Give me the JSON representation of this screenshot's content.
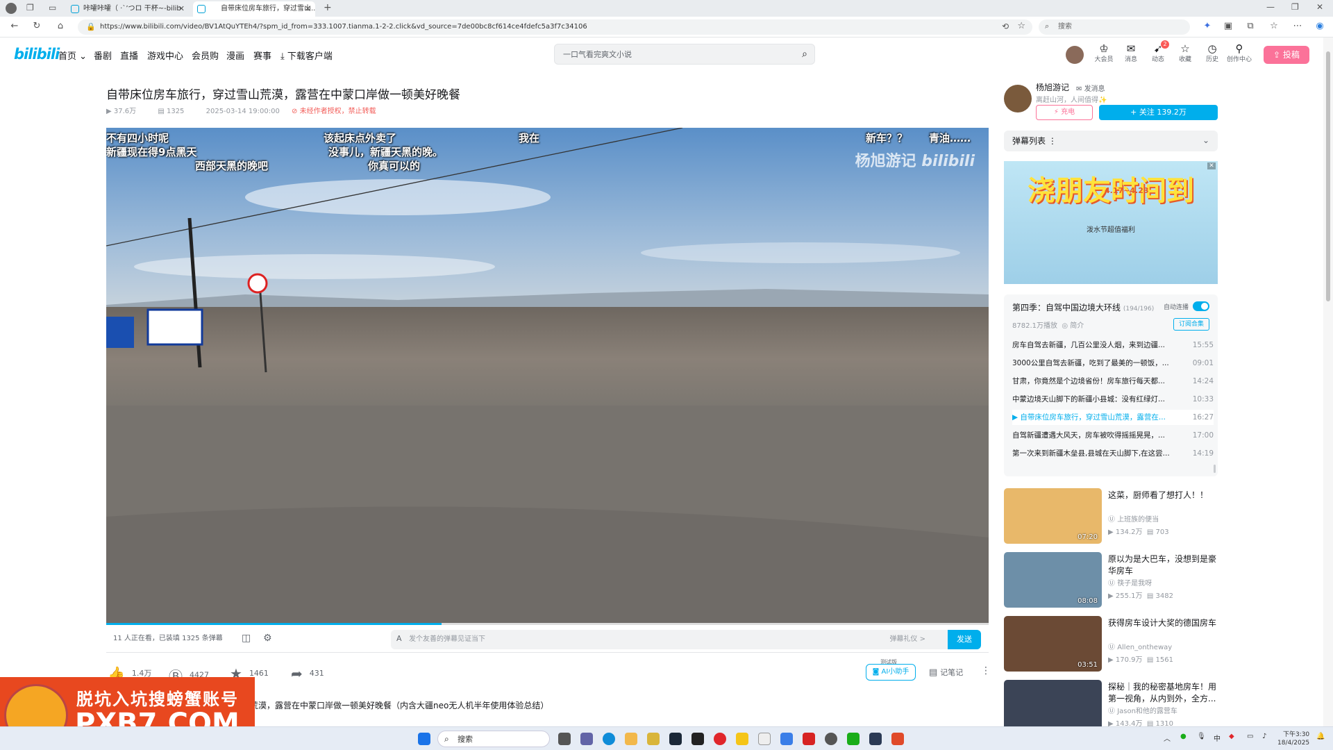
{
  "browser": {
    "tabs": [
      {
        "label": "咔嚯咔嚯（ ·`’つロ 干杯~-bilib",
        "active": false
      },
      {
        "label": "自带床位房车旅行，穿过雪山...",
        "active": true
      }
    ],
    "url": "https://www.bilibili.com/video/BV1AtQuYTEh4/?spm_id_from=333.1007.tianma.1-2-2.click&vd_source=7de00bc8cf614ce4fdefc5a3f7c34106",
    "search_placeholder": "搜索"
  },
  "header": {
    "logo": "bilibili",
    "nav": [
      "首页",
      "番剧",
      "直播",
      "游戏中心",
      "会员购",
      "漫画",
      "赛事",
      "下载客户端"
    ],
    "search_placeholder": "一口气看完爽文小说",
    "right_items": [
      "大会员",
      "消息",
      "动态",
      "收藏",
      "历史",
      "创作中心"
    ],
    "dynamic_badge": "2",
    "upload_label": "投稿"
  },
  "video": {
    "title": "自带床位房车旅行，穿过雪山荒漠，露营在中蒙口岸做一顿美好晚餐",
    "views": "37.6万",
    "danmaku_count": "1325",
    "date": "2025-03-14 19:00:00",
    "copyright": "未经作者授权，禁止转载",
    "watermark": "杨旭游记",
    "danmaku": [
      "不有四小时呢",
      "新疆现在得9点黑天",
      "西部天黑的晚吧",
      "该起床点外卖了",
      "没事儿，新疆天黑的晚。",
      "你真可以的",
      "我在",
      "新车？？",
      "青油……"
    ],
    "progress": 0.38,
    "dm_status": "11 人正在看，已装填 1325 条弹幕",
    "dm_placeholder": "发个友善的弹幕见证当下",
    "dm_etiquette": "弹幕礼仪 >",
    "send_label": "发送",
    "likes": "1.4万",
    "coins": "4427",
    "favorites": "1461",
    "shares": "431",
    "ai_label": "AI小助手",
    "ai_badge": "测试版",
    "notes_label": "记笔记",
    "description": "荒漠，露营在中蒙口岸做一顿美好晚餐（内含大疆neo无人机半年使用体验总结）"
  },
  "promo": {
    "line1": "脱坑入坑搜螃蟹账号",
    "line2": "PXB7.COM"
  },
  "uploader": {
    "name": "杨旭游记",
    "message": "发消息",
    "bio": "离赶山河，人间值得✨",
    "charge_label": "充电",
    "follow_label": "+ 关注 139.2万"
  },
  "danmaku_list_label": "弹幕列表",
  "ad": {
    "headline": "浇朋友时间到",
    "dates": "4.17~4.23",
    "sub": "泼水节超值福利"
  },
  "playlist": {
    "title": "第四季：自驾中国边境大环线",
    "progress": "(194/196)",
    "autoplay": "自动连播",
    "plays": "8782.1万播放",
    "intro": "简介",
    "subscribe": "订阅合集",
    "items": [
      {
        "title": "房车自驾去新疆，几百公里没人烟，来到边疆...",
        "duration": "15:55"
      },
      {
        "title": "3000公里自驾去新疆，吃到了最美的一顿饭，...",
        "duration": "09:01"
      },
      {
        "title": "甘肃，你竟然是个边境省份！房车旅行每天都...",
        "duration": "14:24"
      },
      {
        "title": "中蒙边境天山脚下的新疆小县城：没有红绿灯...",
        "duration": "10:33"
      },
      {
        "title": "自带床位房车旅行，穿过雪山荒漠，露营在...",
        "duration": "16:27",
        "current": true
      },
      {
        "title": "自驾新疆遭遇大风天，房车被吹得摇摇晃晃，...",
        "duration": "17:00"
      },
      {
        "title": "第一次来到新疆木垒县,县城在天山脚下,在这尝...",
        "duration": "14:19"
      }
    ]
  },
  "recommendations": [
    {
      "title": "这菜，厨师看了想打人！！",
      "author": "上班族的便当",
      "views": "134.2万",
      "danmaku": "703",
      "duration": "07:20",
      "color": "#e8b86a"
    },
    {
      "title": "原以为是大巴车，没想到是豪华房车",
      "author": "筷子是我呀",
      "views": "255.1万",
      "danmaku": "3482",
      "duration": "08:08",
      "color": "#6d8fa8"
    },
    {
      "title": "获得房车设计大奖的德国房车",
      "author": "Allen_ontheway",
      "views": "170.9万",
      "danmaku": "1561",
      "duration": "03:51",
      "color": "#6b4a35"
    },
    {
      "title": "探秘｜我的秘密基地房车！用第一视角，从内到外，全方...",
      "author": "Jason和他的露营车",
      "views": "143.4万",
      "danmaku": "1310",
      "duration": "",
      "color": "#3b4456"
    }
  ],
  "taskbar": {
    "search": "搜索",
    "time": "下午3:30",
    "date": "18/4/2025",
    "ime": "中"
  }
}
